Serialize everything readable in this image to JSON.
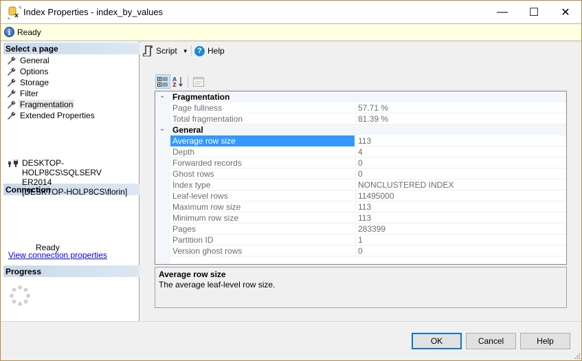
{
  "window": {
    "title": "Index Properties - index_by_values",
    "controls": {
      "minimize": "—",
      "maximize": "☐",
      "close": "✕"
    }
  },
  "status": {
    "icon": "info-icon",
    "text": "Ready"
  },
  "left": {
    "select_page_header": "Select a page",
    "pages": [
      {
        "label": "General",
        "icon": "wrench-icon",
        "selected": false
      },
      {
        "label": "Options",
        "icon": "wrench-icon",
        "selected": false
      },
      {
        "label": "Storage",
        "icon": "wrench-icon",
        "selected": false
      },
      {
        "label": "Filter",
        "icon": "wrench-icon",
        "selected": false
      },
      {
        "label": "Fragmentation",
        "icon": "wrench-icon",
        "selected": true
      },
      {
        "label": "Extended Properties",
        "icon": "wrench-icon",
        "selected": false
      }
    ],
    "connection_header": "Connection",
    "connection_server_line1": "DESKTOP-HOLP8CS\\SQLSERV",
    "connection_server_line2": "ER2014",
    "connection_user": "[DESKTOP-HOLP8CS\\florin]",
    "connection_link": "View connection properties",
    "progress_header": "Progress",
    "progress_status": "Ready"
  },
  "toolbar": {
    "script_label": "Script",
    "help_label": "Help"
  },
  "grid": {
    "categories": [
      {
        "label": "Fragmentation",
        "rows": [
          {
            "name": "Page fullness",
            "value": "57.71 %"
          },
          {
            "name": "Total fragmentation",
            "value": "81.39 %"
          }
        ]
      },
      {
        "label": "General",
        "rows": [
          {
            "name": "Average row size",
            "value": "113",
            "selected": true
          },
          {
            "name": "Depth",
            "value": "4"
          },
          {
            "name": "Forwarded records",
            "value": "0"
          },
          {
            "name": "Ghost rows",
            "value": "0"
          },
          {
            "name": "Index type",
            "value": "NONCLUSTERED INDEX"
          },
          {
            "name": "Leaf-level rows",
            "value": "11495000"
          },
          {
            "name": "Maximum row size",
            "value": "113"
          },
          {
            "name": "Minimum row size",
            "value": "113"
          },
          {
            "name": "Pages",
            "value": "283399"
          },
          {
            "name": "Partition ID",
            "value": "1"
          },
          {
            "name": "Version ghost rows",
            "value": "0"
          }
        ]
      }
    ]
  },
  "description": {
    "title": "Average row size",
    "text": "The average leaf-level row size."
  },
  "buttons": {
    "ok": "OK",
    "cancel": "Cancel",
    "help": "Help"
  },
  "colors": {
    "selection": "#3399ff",
    "status_bg": "#ffffe1",
    "default_button_border": "#0078d7",
    "link": "#0000ee"
  }
}
